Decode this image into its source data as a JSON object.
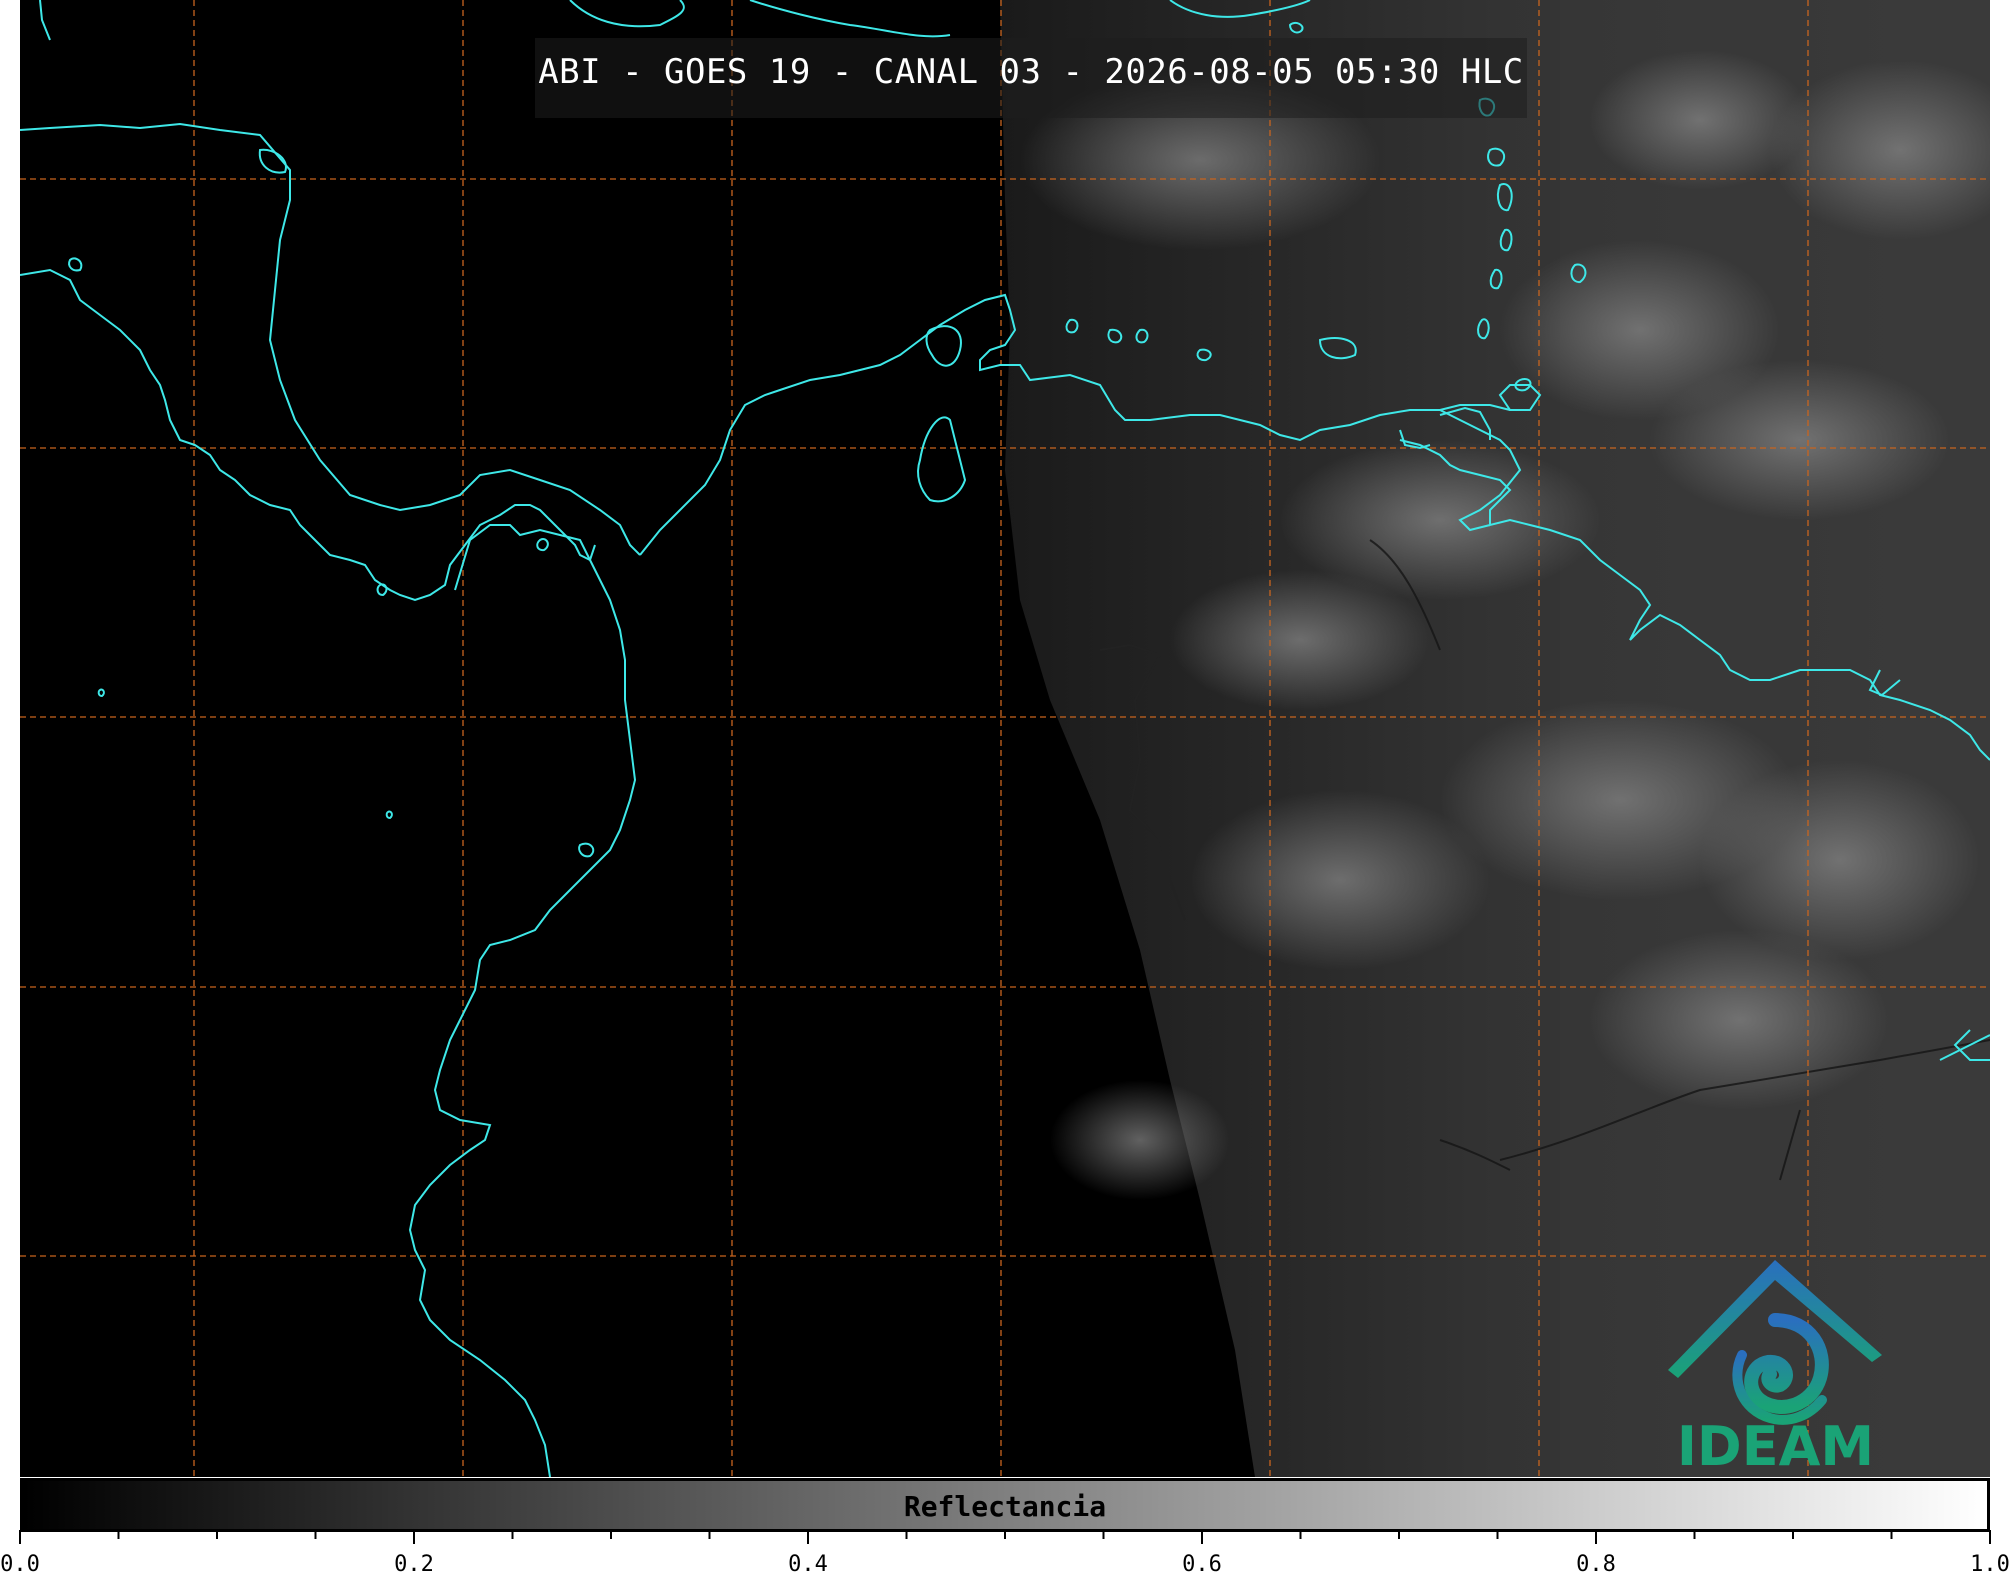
{
  "title": "ABI - GOES 19 - CANAL 03 - 2026-08-05 05:30 HLC",
  "colorbar": {
    "label": "Reflectancia",
    "ticks": [
      "0.0",
      "0.2",
      "0.4",
      "0.6",
      "0.8",
      "1.0"
    ],
    "range": [
      0.0,
      1.0
    ],
    "colormap": "greyscale"
  },
  "logo": {
    "text": "IDEAM",
    "icon": "ideam-logo-icon"
  },
  "colors": {
    "coastline": "#3ee8e8",
    "gridlines": "#d2691e",
    "logo_green": "#1aa376",
    "logo_blue": "#2a6fbf"
  },
  "gridlines": "dashed"
}
